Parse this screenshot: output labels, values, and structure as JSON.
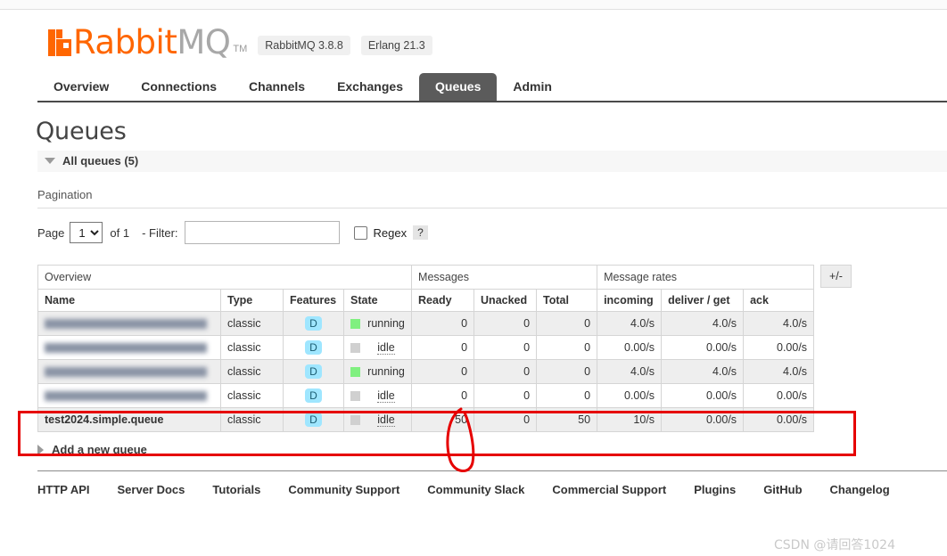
{
  "header": {
    "logo_text_primary": "Rabbit",
    "logo_text_secondary": "MQ",
    "logo_tm": "TM",
    "version_badge": "RabbitMQ 3.8.8",
    "erlang_badge": "Erlang 21.3"
  },
  "nav": {
    "items": [
      {
        "label": "Overview",
        "active": false
      },
      {
        "label": "Connections",
        "active": false
      },
      {
        "label": "Channels",
        "active": false
      },
      {
        "label": "Exchanges",
        "active": false
      },
      {
        "label": "Queues",
        "active": true
      },
      {
        "label": "Admin",
        "active": false
      }
    ]
  },
  "main": {
    "title": "Queues",
    "all_queues_label": "All queues (5)",
    "pagination_section_label": "Pagination",
    "pagination": {
      "page_label": "Page",
      "page_value": "1",
      "page_options": [
        "1"
      ],
      "of_label": "of 1",
      "filter_label": "- Filter:",
      "filter_value": "",
      "filter_placeholder": "",
      "regex_label": "Regex",
      "help_label": "?"
    },
    "table": {
      "group_headers": [
        {
          "label": "Overview",
          "span": 4
        },
        {
          "label": "Messages",
          "span": 3
        },
        {
          "label": "Message rates",
          "span": 3
        }
      ],
      "columns": [
        "Name",
        "Type",
        "Features",
        "State",
        "Ready",
        "Unacked",
        "Total",
        "incoming",
        "deliver / get",
        "ack"
      ],
      "toggle_columns_label": "+/-",
      "rows": [
        {
          "name": "",
          "redacted": true,
          "type": "classic",
          "features": "D",
          "state": "running",
          "ready": "0",
          "unacked": "0",
          "total": "0",
          "incoming": "4.0/s",
          "deliver_get": "4.0/s",
          "ack": "4.0/s",
          "highlighted": false
        },
        {
          "name": "",
          "redacted": true,
          "type": "classic",
          "features": "D",
          "state": "idle",
          "ready": "0",
          "unacked": "0",
          "total": "0",
          "incoming": "0.00/s",
          "deliver_get": "0.00/s",
          "ack": "0.00/s",
          "highlighted": false
        },
        {
          "name": "",
          "redacted": true,
          "type": "classic",
          "features": "D",
          "state": "running",
          "ready": "0",
          "unacked": "0",
          "total": "0",
          "incoming": "4.0/s",
          "deliver_get": "4.0/s",
          "ack": "4.0/s",
          "highlighted": false
        },
        {
          "name": "",
          "redacted": true,
          "type": "classic",
          "features": "D",
          "state": "idle",
          "ready": "0",
          "unacked": "0",
          "total": "0",
          "incoming": "0.00/s",
          "deliver_get": "0.00/s",
          "ack": "0.00/s",
          "highlighted": false
        },
        {
          "name": "test2024.simple.queue",
          "redacted": false,
          "type": "classic",
          "features": "D",
          "state": "idle",
          "ready": "50",
          "unacked": "0",
          "total": "50",
          "incoming": "10/s",
          "deliver_get": "0.00/s",
          "ack": "0.00/s",
          "highlighted": true
        }
      ]
    },
    "add_queue_label": "Add a new queue"
  },
  "footer": {
    "links": [
      "HTTP API",
      "Server Docs",
      "Tutorials",
      "Community Support",
      "Community Slack",
      "Commercial Support",
      "Plugins",
      "GitHub",
      "Changelog"
    ]
  },
  "watermark": "CSDN @请回答1024",
  "colors": {
    "brand_orange": "#ff6600",
    "active_tab": "#5b5b5b",
    "running_state": "#80f080",
    "idle_state": "#d0d0d0",
    "feature_badge": "#9fe6ff",
    "annotation_red": "#e60000"
  }
}
